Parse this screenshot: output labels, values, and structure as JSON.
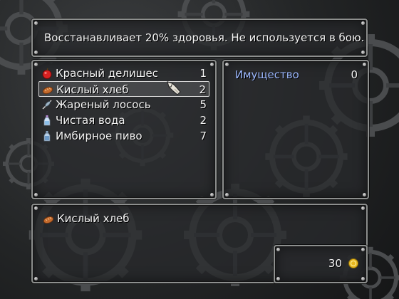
{
  "help": {
    "text": "Восстанавливает 20% здоровья. Не используется в бою."
  },
  "items": [
    {
      "name": "Красный делишес",
      "qty": "1",
      "icon": "apple-icon",
      "selected": false
    },
    {
      "name": "Кислый хлеб",
      "qty": "2",
      "icon": "bread-icon",
      "selected": true
    },
    {
      "name": "Жареный лосось",
      "qty": "5",
      "icon": "fish-skewer-icon",
      "selected": false
    },
    {
      "name": "Чистая вода",
      "qty": "2",
      "icon": "water-bottle-icon",
      "selected": false
    },
    {
      "name": "Имбирное пиво",
      "qty": "7",
      "icon": "ginger-beer-bottle-icon",
      "selected": false
    }
  ],
  "category": {
    "label": "Имущество",
    "count": "0"
  },
  "description": {
    "name": "Кислый хлеб",
    "icon": "bread-icon"
  },
  "gold": {
    "value": "30",
    "icon": "gold-coin-icon"
  },
  "colors": {
    "category_label": "#9cb8ff",
    "window_border": "#8d8f8e",
    "text": "#f4f4f4"
  }
}
